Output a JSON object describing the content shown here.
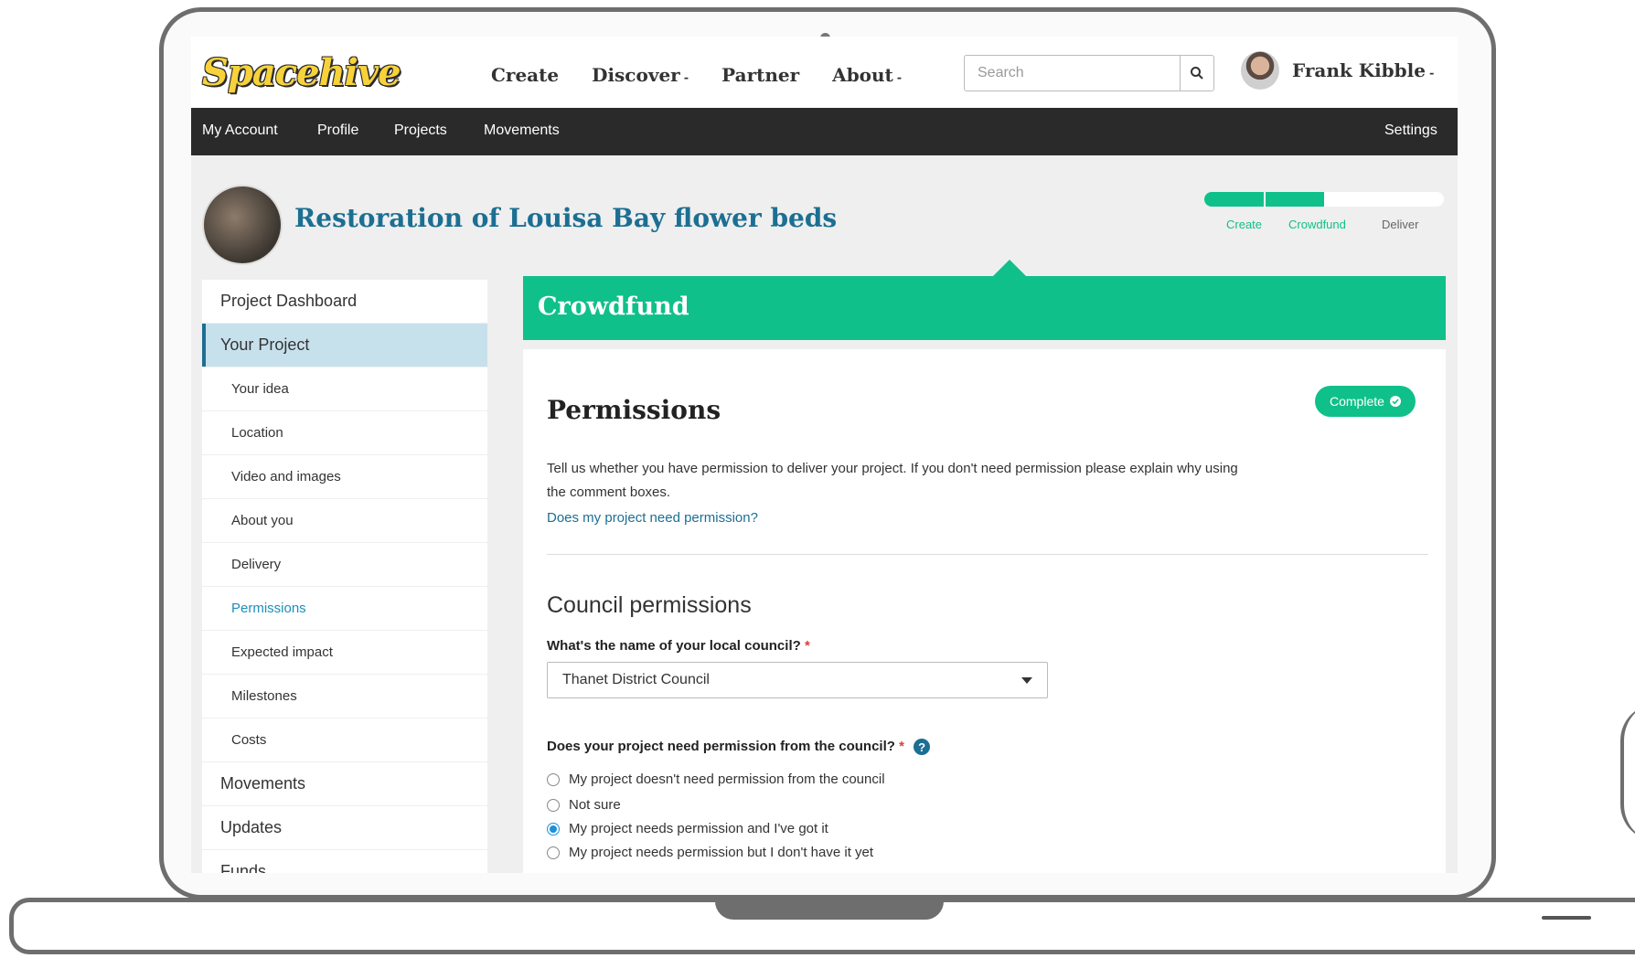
{
  "brand": {
    "logo_text": "Spacehive",
    "logo_color": "#f7d23a"
  },
  "nav": {
    "items": [
      {
        "label": "Create",
        "has_caret": false
      },
      {
        "label": "Discover",
        "has_caret": true
      },
      {
        "label": "Partner",
        "has_caret": false
      },
      {
        "label": "About",
        "has_caret": true
      }
    ],
    "caret": "-"
  },
  "search": {
    "placeholder": "Search",
    "icon": "search-icon"
  },
  "user": {
    "name": "Frank Kibble",
    "caret": "-"
  },
  "subnav": {
    "items": [
      "My Account",
      "Profile",
      "Projects",
      "Movements"
    ],
    "settings": "Settings"
  },
  "project": {
    "title": "Restoration of Louisa Bay flower beds",
    "stages": [
      {
        "label": "Create",
        "state": "done"
      },
      {
        "label": "Crowdfund",
        "state": "current"
      },
      {
        "label": "Deliver",
        "state": "todo"
      }
    ],
    "progress_fraction": 0.5
  },
  "sidebar": {
    "items": [
      {
        "label": "Project Dashboard",
        "type": "top"
      },
      {
        "label": "Your Project",
        "type": "top",
        "active": true
      },
      {
        "label": "Your idea",
        "type": "sub"
      },
      {
        "label": "Location",
        "type": "sub"
      },
      {
        "label": "Video and images",
        "type": "sub"
      },
      {
        "label": "About you",
        "type": "sub"
      },
      {
        "label": "Delivery",
        "type": "sub"
      },
      {
        "label": "Permissions",
        "type": "sub",
        "current": true
      },
      {
        "label": "Expected impact",
        "type": "sub"
      },
      {
        "label": "Milestones",
        "type": "sub"
      },
      {
        "label": "Costs",
        "type": "sub"
      },
      {
        "label": "Movements",
        "type": "top"
      },
      {
        "label": "Updates",
        "type": "top"
      },
      {
        "label": "Funds",
        "type": "top"
      }
    ]
  },
  "main": {
    "banner": "Crowdfund",
    "heading": "Permissions",
    "badge": "Complete",
    "description": "Tell us whether you have permission to deliver your project. If you don't need permission please explain why using the comment boxes.",
    "help_link": "Does my project need permission?",
    "section": "Council permissions",
    "council_question": "What's the name of your local council?",
    "required_mark": "*",
    "council_value": "Thanet District Council",
    "permission_question": "Does your project need permission from the council?",
    "help_icon_glyph": "?",
    "options": [
      {
        "label": "My project doesn't need permission from the council",
        "selected": false
      },
      {
        "label": "Not sure",
        "selected": false
      },
      {
        "label": "My project needs permission and I've got it",
        "selected": true
      },
      {
        "label": "My project needs permission but I don't have it yet",
        "selected": false
      }
    ]
  },
  "colors": {
    "accent_green": "#10c08a",
    "link_blue": "#1c6f92",
    "dark_bar": "#2a2a2a"
  }
}
